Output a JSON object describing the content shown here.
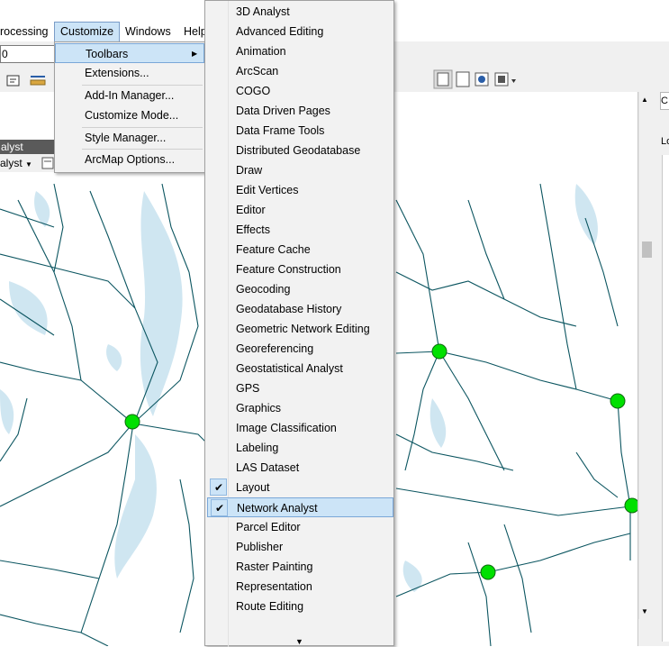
{
  "menubar": {
    "items": [
      "rocessing",
      "Customize",
      "Windows",
      "Help"
    ]
  },
  "toolbar": {
    "combo_value": "0"
  },
  "na_window": {
    "title": "alyst",
    "dropdown_label": "alyst"
  },
  "customize_menu": {
    "items": [
      "Toolbars",
      "Extensions...",
      "Add-In Manager...",
      "Customize Mode...",
      "Style Manager...",
      "ArcMap Options..."
    ],
    "submenu_arrow": "▶"
  },
  "toolbars_menu": {
    "items": [
      {
        "label": "3D Analyst",
        "checked": false
      },
      {
        "label": "Advanced Editing",
        "checked": false
      },
      {
        "label": "Animation",
        "checked": false
      },
      {
        "label": "ArcScan",
        "checked": false
      },
      {
        "label": "COGO",
        "checked": false
      },
      {
        "label": "Data Driven Pages",
        "checked": false
      },
      {
        "label": "Data Frame Tools",
        "checked": false
      },
      {
        "label": "Distributed Geodatabase",
        "checked": false
      },
      {
        "label": "Draw",
        "checked": false
      },
      {
        "label": "Edit Vertices",
        "checked": false
      },
      {
        "label": "Editor",
        "checked": false
      },
      {
        "label": "Effects",
        "checked": false
      },
      {
        "label": "Feature Cache",
        "checked": false
      },
      {
        "label": "Feature Construction",
        "checked": false
      },
      {
        "label": "Geocoding",
        "checked": false
      },
      {
        "label": "Geodatabase History",
        "checked": false
      },
      {
        "label": "Geometric Network Editing",
        "checked": false
      },
      {
        "label": "Georeferencing",
        "checked": false
      },
      {
        "label": "Geostatistical Analyst",
        "checked": false
      },
      {
        "label": "GPS",
        "checked": false
      },
      {
        "label": "Graphics",
        "checked": false
      },
      {
        "label": "Image Classification",
        "checked": false
      },
      {
        "label": "Labeling",
        "checked": false
      },
      {
        "label": "LAS Dataset",
        "checked": false
      },
      {
        "label": "Layout",
        "checked": true
      },
      {
        "label": "Network Analyst",
        "checked": true,
        "highlighted": true
      },
      {
        "label": "Parcel Editor",
        "checked": false
      },
      {
        "label": "Publisher",
        "checked": false
      },
      {
        "label": "Raster Painting",
        "checked": false
      },
      {
        "label": "Representation",
        "checked": false
      },
      {
        "label": "Route Editing",
        "checked": false
      }
    ],
    "check_glyph": "✔",
    "more_arrow": "▼"
  },
  "right_pane": {
    "tab": "C",
    "label": "Lo"
  },
  "colors": {
    "road": "#0b5560",
    "water": "#cfe6f1",
    "stop": "#00e000",
    "highlight": "#cce4f7"
  }
}
